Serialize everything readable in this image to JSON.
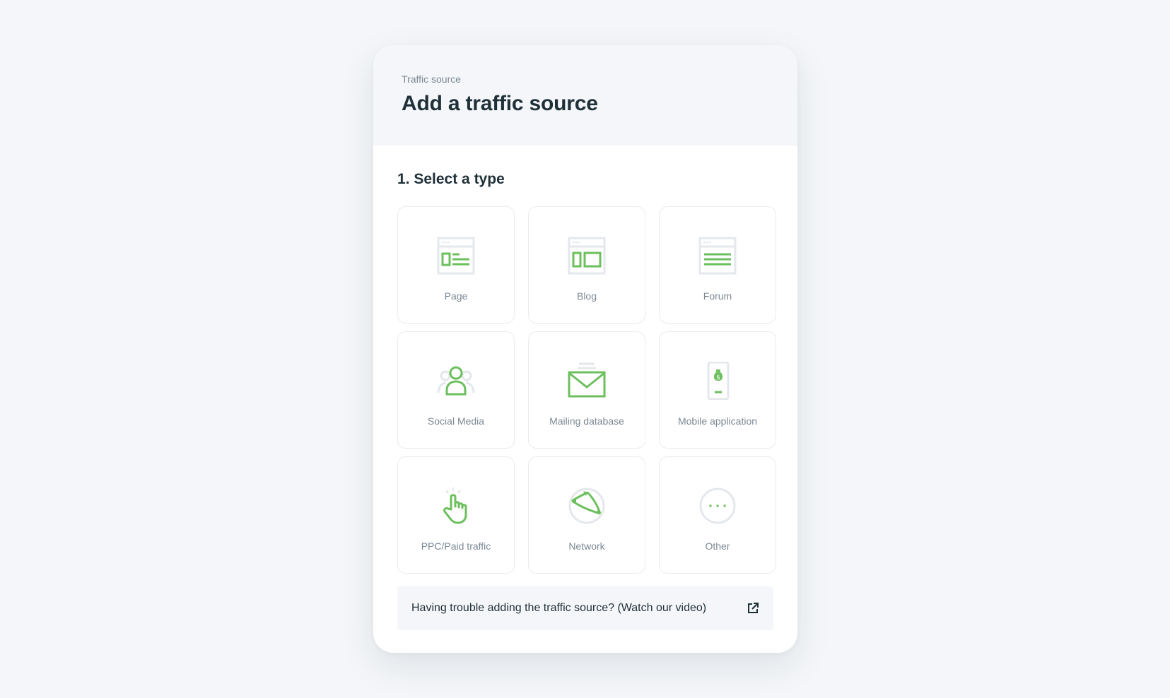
{
  "modal": {
    "eyebrow": "Traffic source",
    "title": "Add a traffic source"
  },
  "step": {
    "title": "1. Select a type"
  },
  "types": [
    {
      "label": "Page",
      "icon": "page-icon"
    },
    {
      "label": "Blog",
      "icon": "blog-icon"
    },
    {
      "label": "Forum",
      "icon": "forum-icon"
    },
    {
      "label": "Social Media",
      "icon": "social-media-icon"
    },
    {
      "label": "Mailing database",
      "icon": "mail-icon"
    },
    {
      "label": "Mobile application",
      "icon": "mobile-app-icon"
    },
    {
      "label": "PPC/Paid traffic",
      "icon": "pointer-click-icon"
    },
    {
      "label": "Network",
      "icon": "network-icon"
    },
    {
      "label": "Other",
      "icon": "more-dots-icon"
    }
  ],
  "help": {
    "text": "Having trouble adding the traffic source? (Watch our video)",
    "icon": "external-link-icon"
  },
  "colors": {
    "accent": "#6cbf5d",
    "icon_gray": "#e4e8ec",
    "title": "#1f3038",
    "muted": "#7b8894"
  }
}
